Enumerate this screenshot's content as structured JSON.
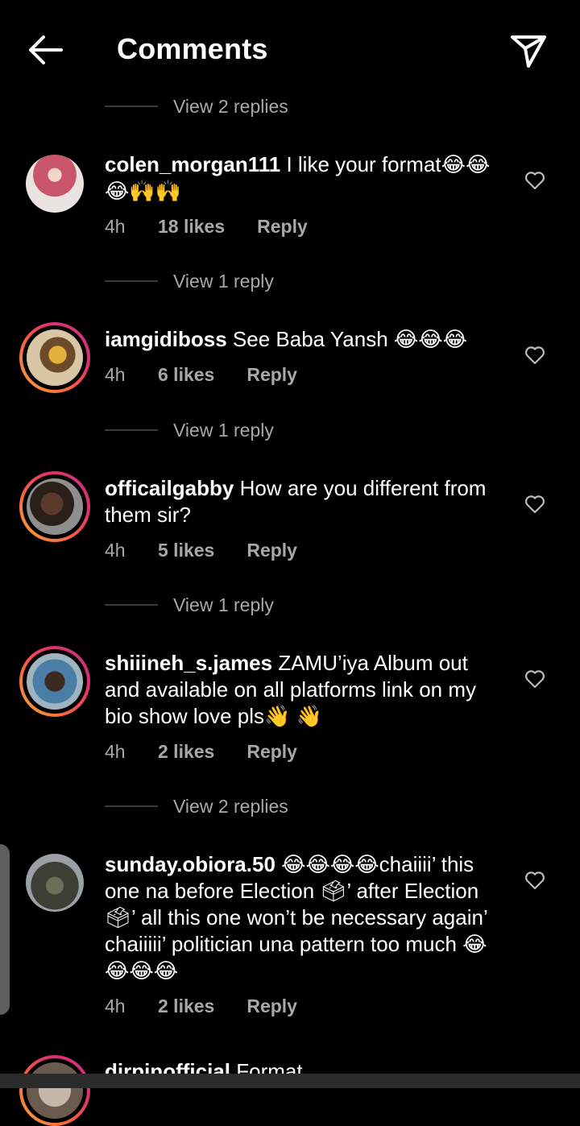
{
  "header": {
    "title": "Comments",
    "back_icon": "arrow-left-icon",
    "share_icon": "paper-plane-icon"
  },
  "view_replies": [
    "View 2 replies",
    "View 1 reply",
    "View 1 reply",
    "View 1 reply",
    "View 2 replies"
  ],
  "comments": [
    {
      "username": "colen_morgan111",
      "text": " I like your format😂😂😂🙌🙌",
      "time": "4h",
      "likes": "18 likes",
      "reply": "Reply"
    },
    {
      "username": "iamgidiboss",
      "text": " See Baba Yansh 😂😂😂",
      "time": "4h",
      "likes": "6 likes",
      "reply": "Reply"
    },
    {
      "username": "officailgabby",
      "text": " How are you different from them sir?",
      "time": "4h",
      "likes": "5 likes",
      "reply": "Reply"
    },
    {
      "username": "shiiineh_s.james",
      "text": " ZAMU’iya Album out and available on all platforms link on my bio show love pls👋 👋",
      "time": "4h",
      "likes": "2 likes",
      "reply": "Reply"
    },
    {
      "username": "sunday.obiora.50",
      "text": " 😂😂😂😂chaiiii’ this one na before Election 🗳’ after Election 🗳’ all this one won’t be necessary again’ chaiiiii’ politician una pattern too much 😂😂😂😂",
      "time": "4h",
      "likes": "2 likes",
      "reply": "Reply"
    },
    {
      "username": "dirpinofficial",
      "text": " Format"
    }
  ],
  "colors": {
    "background": "#000000",
    "secondary_text": "#a8a8a8",
    "story_ring": "#e1306c"
  }
}
